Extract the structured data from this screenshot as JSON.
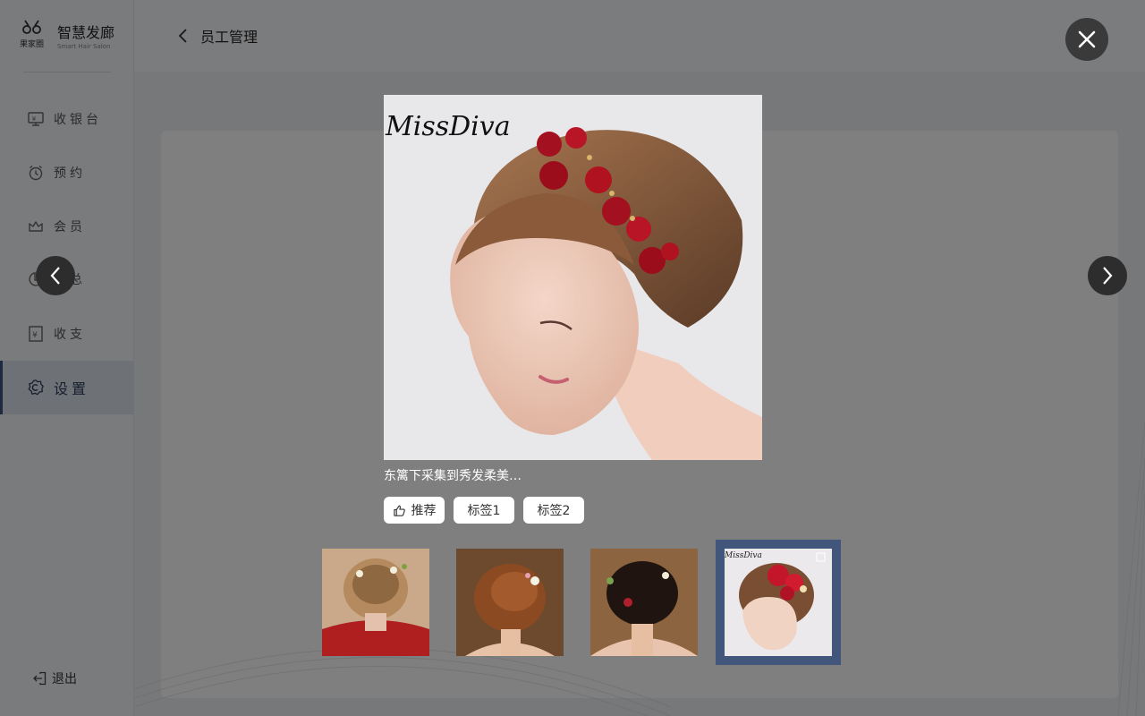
{
  "brand": {
    "logo_text": "果家圈",
    "name": "智慧发廊",
    "subtitle": "Smart Hair Salon"
  },
  "sidebar": {
    "items": [
      {
        "label": "收银台",
        "icon": "cashier-icon"
      },
      {
        "label": "预约",
        "icon": "alarm-clock-icon"
      },
      {
        "label": "会员",
        "icon": "crown-icon"
      },
      {
        "label": "汇总",
        "icon": "pie-chart-icon"
      },
      {
        "label": "收支",
        "icon": "ledger-icon"
      },
      {
        "label": "设置",
        "icon": "gear-icon",
        "active": true
      }
    ],
    "logout_label": "退出"
  },
  "header": {
    "back_label": "员工管理"
  },
  "viewer": {
    "watermark": "MissDiva",
    "caption": "东篱下采集到秀发柔美…",
    "like_label": "推荐",
    "tags": [
      "标签1",
      "标签2"
    ],
    "thumbnails": [
      {
        "name": "hair-thumb-1",
        "active": false
      },
      {
        "name": "hair-thumb-2",
        "active": false
      },
      {
        "name": "hair-thumb-3",
        "active": false
      },
      {
        "name": "hair-thumb-4",
        "active": true,
        "watermark": "MissDiva"
      }
    ]
  },
  "colors": {
    "accent": "#41567a",
    "overlay": "rgba(0,0,0,0.5)",
    "flower_red": "#a3101f"
  }
}
